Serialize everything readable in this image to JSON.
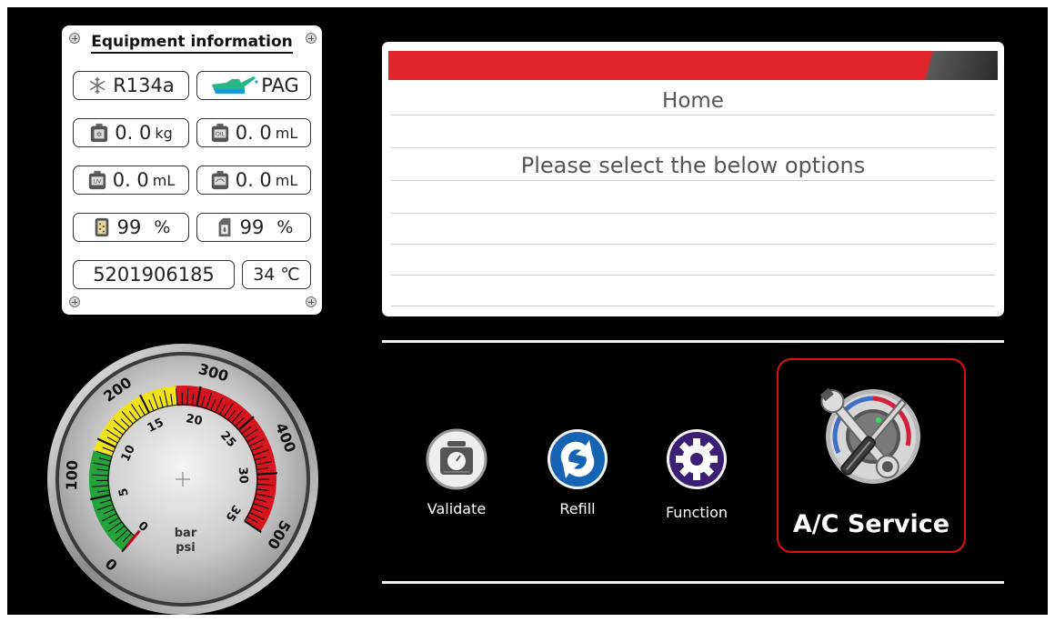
{
  "equipment": {
    "title": "Equipment information",
    "refrigerant": "R134a",
    "oil_type": "PAG",
    "refrigerant_weight": {
      "value": "0. 0",
      "unit": "kg"
    },
    "oil_volume": {
      "value": "0. 0",
      "unit": "mL"
    },
    "uv_volume": {
      "value": "0. 0",
      "unit": "mL"
    },
    "waste_oil_volume": {
      "value": "0. 0",
      "unit": "mL"
    },
    "filter_level": {
      "value": "99",
      "unit": "%"
    },
    "oil_bottle_level": {
      "value": "99",
      "unit": "%"
    },
    "serial_number": "5201906185",
    "temperature": "34 ℃",
    "icons": [
      "snowflake-icon",
      "oil-can-icon",
      "refrigerant-scale-icon",
      "oil-scale-icon",
      "uv-scale-icon",
      "waste-oil-scale-icon",
      "filter-icon",
      "oil-bottle-icon"
    ]
  },
  "display": {
    "title": "Home",
    "message": "Please select the below options"
  },
  "buttons": {
    "validate": "Validate",
    "refill": "Refill",
    "function": "Function",
    "ac_service": "A/C Service"
  },
  "gauge": {
    "unit_bar": "bar",
    "unit_psi": "psi",
    "psi_ticks": [
      "0",
      "100",
      "200",
      "300",
      "400",
      "500"
    ],
    "bar_ticks": [
      "0",
      "5",
      "10",
      "15",
      "20",
      "25",
      "30",
      "35"
    ],
    "value_bar": 0
  },
  "colors": {
    "accent_red": "#e1252c",
    "gauge_green": "#23a339",
    "gauge_yellow": "#f1e21c",
    "gauge_red": "#d5161e",
    "refill_blue": "#1763b3",
    "function_purple": "#3a1f74",
    "highlight_border": "#e01010"
  }
}
